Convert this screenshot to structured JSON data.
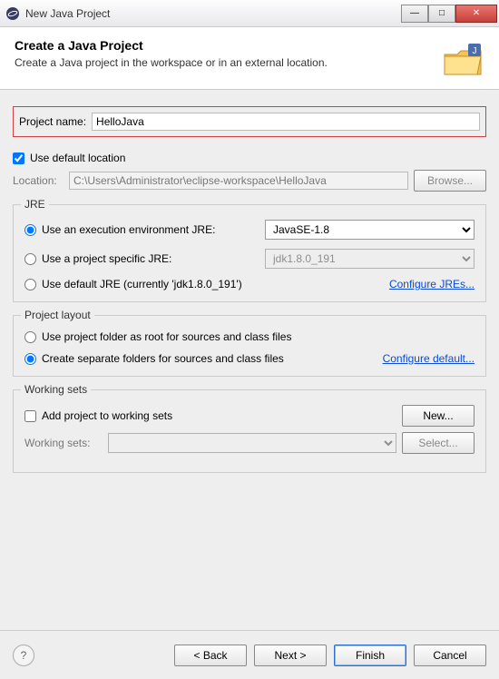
{
  "window": {
    "title": "New Java Project"
  },
  "header": {
    "title": "Create a Java Project",
    "description": "Create a Java project in the workspace or in an external location."
  },
  "project": {
    "name_label": "Project name:",
    "name_value": "HelloJava",
    "use_default_label": "Use default location",
    "use_default_checked": true,
    "location_label": "Location:",
    "location_value": "C:\\Users\\Administrator\\eclipse-workspace\\HelloJava",
    "browse_label": "Browse..."
  },
  "jre": {
    "section_title": "JRE",
    "exec_env_label": "Use an execution environment JRE:",
    "exec_env_value": "JavaSE-1.8",
    "project_specific_label": "Use a project specific JRE:",
    "project_specific_value": "jdk1.8.0_191",
    "default_jre_label": "Use default JRE (currently 'jdk1.8.0_191')",
    "configure_link": "Configure JREs...",
    "selected": "exec_env"
  },
  "layout": {
    "section_title": "Project layout",
    "root_folder_label": "Use project folder as root for sources and class files",
    "separate_folders_label": "Create separate folders for sources and class files",
    "configure_link": "Configure default...",
    "selected": "separate"
  },
  "working_sets": {
    "section_title": "Working sets",
    "add_label": "Add project to working sets",
    "add_checked": false,
    "new_label": "New...",
    "sets_label": "Working sets:",
    "select_label": "Select..."
  },
  "footer": {
    "back": "< Back",
    "next": "Next >",
    "finish": "Finish",
    "cancel": "Cancel",
    "help": "?"
  }
}
